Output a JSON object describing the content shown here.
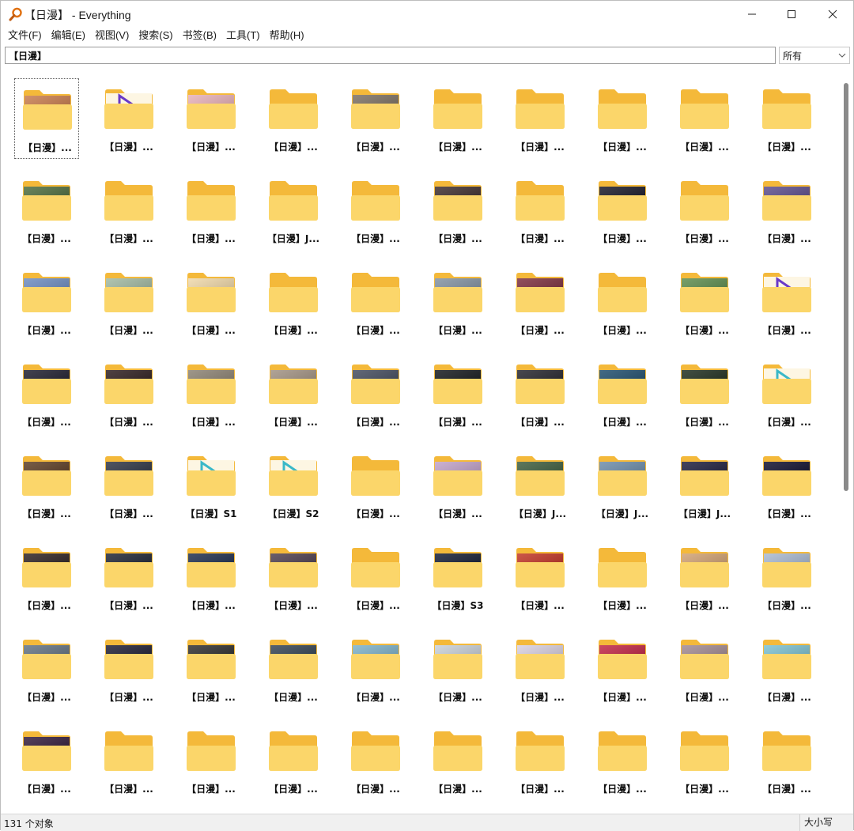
{
  "window": {
    "title": "【日漫】 - Everything",
    "minimize_label": "minimize",
    "maximize_label": "maximize",
    "close_label": "close"
  },
  "menu": [
    "文件(F)",
    "编辑(E)",
    "视图(V)",
    "搜索(S)",
    "书签(B)",
    "工具(T)",
    "帮助(H)"
  ],
  "search": {
    "value": "【日漫】",
    "filter_value": "所有"
  },
  "colors": {
    "folder_back": "#f4b93a",
    "folder_front": "#fbd66a",
    "accent": "#f0a020"
  },
  "tiles": [
    {
      "label": "【日漫】...",
      "thumb": "#c87a4a",
      "selected": true
    },
    {
      "label": "【日漫】...",
      "thumb": "logo"
    },
    {
      "label": "【日漫】...",
      "thumb": "#e8b0b8"
    },
    {
      "label": "【日漫】...",
      "thumb": null
    },
    {
      "label": "【日漫】...",
      "thumb": "#7a6e60"
    },
    {
      "label": "【日漫】...",
      "thumb": null
    },
    {
      "label": "【日漫】...",
      "thumb": null
    },
    {
      "label": "【日漫】...",
      "thumb": null
    },
    {
      "label": "【日漫】...",
      "thumb": null
    },
    {
      "label": "【日漫】...",
      "thumb": null
    },
    {
      "label": "【日漫】...",
      "thumb": "#4a6a3a"
    },
    {
      "label": "【日漫】...",
      "thumb": null
    },
    {
      "label": "【日漫】...",
      "thumb": null
    },
    {
      "label": "【日漫】J...",
      "thumb": null
    },
    {
      "label": "【日漫】...",
      "thumb": null
    },
    {
      "label": "【日漫】...",
      "thumb": "#3a2a2a"
    },
    {
      "label": "【日漫】...",
      "thumb": null
    },
    {
      "label": "【日漫】...",
      "thumb": "#141424"
    },
    {
      "label": "【日漫】...",
      "thumb": null
    },
    {
      "label": "【日漫】...",
      "thumb": "#5a4a8a"
    },
    {
      "label": "【日漫】...",
      "thumb": "#6a8ac0"
    },
    {
      "label": "【日漫】...",
      "thumb": "#a0b8a0"
    },
    {
      "label": "【日漫】...",
      "thumb": "#f0d8a8"
    },
    {
      "label": "【日漫】...",
      "thumb": null
    },
    {
      "label": "【日漫】...",
      "thumb": null
    },
    {
      "label": "【日漫】...",
      "thumb": "#8090a0"
    },
    {
      "label": "【日漫】...",
      "thumb": "#7a2a3a"
    },
    {
      "label": "【日漫】...",
      "thumb": null
    },
    {
      "label": "【日漫】...",
      "thumb": "#5a8a4a"
    },
    {
      "label": "【日漫】...",
      "thumb": "logo"
    },
    {
      "label": "【日漫】...",
      "thumb": "#1a1a2a"
    },
    {
      "label": "【日漫】...",
      "thumb": "#2a1a1a"
    },
    {
      "label": "【日漫】...",
      "thumb": "#8a8070"
    },
    {
      "label": "【日漫】...",
      "thumb": "#a09080"
    },
    {
      "label": "【日漫】...",
      "thumb": "#40485a"
    },
    {
      "label": "【日漫】...",
      "thumb": "#101418"
    },
    {
      "label": "【日漫】...",
      "thumb": "#202028"
    },
    {
      "label": "【日漫】...",
      "thumb": "#1a4a6a"
    },
    {
      "label": "【日漫】...",
      "thumb": "#1a2a1a"
    },
    {
      "label": "【日漫】...",
      "thumb": "logo2"
    },
    {
      "label": "【日漫】...",
      "thumb": "#5a3a20"
    },
    {
      "label": "【日漫】...",
      "thumb": "#2a3040"
    },
    {
      "label": "【日漫】S1",
      "thumb": "logo2"
    },
    {
      "label": "【日漫】S2",
      "thumb": "logo2"
    },
    {
      "label": "【日漫】...",
      "thumb": null
    },
    {
      "label": "【日漫】...",
      "thumb": "#c0a0c8"
    },
    {
      "label": "【日漫】J...",
      "thumb": "#3a5a3a"
    },
    {
      "label": "【日漫】J...",
      "thumb": "#6a8aa8"
    },
    {
      "label": "【日漫】J...",
      "thumb": "#1a1a3a"
    },
    {
      "label": "【日漫】...",
      "thumb": "#0a0a2a"
    },
    {
      "label": "【日漫】...",
      "thumb": "#2a1e1e"
    },
    {
      "label": "【日漫】...",
      "thumb": "#1a2030"
    },
    {
      "label": "【日漫】...",
      "thumb": "#1a2a4a"
    },
    {
      "label": "【日漫】...",
      "thumb": "#4a3a4a"
    },
    {
      "label": "【日漫】...",
      "thumb": null
    },
    {
      "label": "【日漫】S3",
      "thumb": "#101830"
    },
    {
      "label": "【日漫】...",
      "thumb": "#c03020"
    },
    {
      "label": "【日漫】...",
      "thumb": null
    },
    {
      "label": "【日漫】...",
      "thumb": "#d0a070"
    },
    {
      "label": "【日漫】...",
      "thumb": "#a8b8d0"
    },
    {
      "label": "【日漫】...",
      "thumb": "#607080"
    },
    {
      "label": "【日漫】...",
      "thumb": "#1a1a30"
    },
    {
      "label": "【日漫】...",
      "thumb": "#2a2a2a"
    },
    {
      "label": "【日漫】...",
      "thumb": "#304050"
    },
    {
      "label": "【日漫】...",
      "thumb": "#7ab0c8"
    },
    {
      "label": "【日漫】...",
      "thumb": "#c8d0d8"
    },
    {
      "label": "【日漫】...",
      "thumb": "#d8d0e0"
    },
    {
      "label": "【日漫】...",
      "thumb": "#c02040"
    },
    {
      "label": "【日漫】...",
      "thumb": "#a08890"
    },
    {
      "label": "【日漫】...",
      "thumb": "#7ac0d0"
    },
    {
      "label": "【日漫】...",
      "thumb": "#301838"
    },
    {
      "label": "【日漫】...",
      "thumb": null
    },
    {
      "label": "【日漫】...",
      "thumb": null
    },
    {
      "label": "【日漫】...",
      "thumb": null
    },
    {
      "label": "【日漫】...",
      "thumb": null
    },
    {
      "label": "【日漫】...",
      "thumb": null
    },
    {
      "label": "【日漫】...",
      "thumb": null
    },
    {
      "label": "【日漫】...",
      "thumb": null
    },
    {
      "label": "【日漫】...",
      "thumb": null
    },
    {
      "label": "【日漫】...",
      "thumb": null
    }
  ],
  "status": {
    "count": "131 个对象",
    "case": "大小写"
  }
}
